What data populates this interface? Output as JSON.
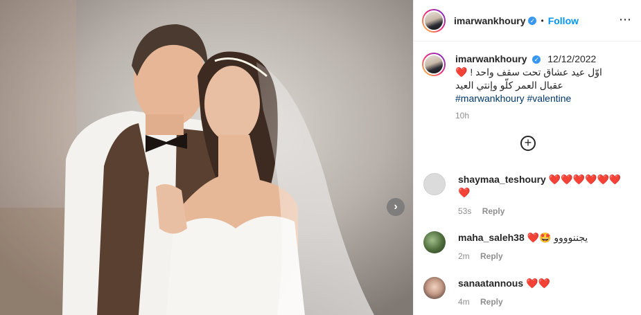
{
  "post": {
    "username": "imarwankhoury",
    "follow_label": "Follow",
    "dot": "•",
    "more_label": "⋯",
    "next_label": "›"
  },
  "caption": {
    "username": "imarwankhoury",
    "date": "12/12/2022",
    "line1": "اوّل عيد عشاق تحت سقف واحد !",
    "line1_emoji": "❤️",
    "line2": "عقبال العمر كلّو وإنتي العيد",
    "hashtag1": "#marwankhoury",
    "hashtag2": "#valentine",
    "time": "10h"
  },
  "load_more": "+",
  "comments": [
    {
      "username": "shaymaa_teshoury",
      "text": "❤️❤️❤️❤️❤️❤️❤️",
      "time": "53s",
      "reply": "Reply"
    },
    {
      "username": "maha_saleh38",
      "text": "يجننوووو 🤩❤️",
      "time": "2m",
      "reply": "Reply"
    },
    {
      "username": "sanaatannous",
      "text": "❤️❤️",
      "time": "4m",
      "reply": "Reply"
    }
  ],
  "colors": {
    "link": "#0095f6",
    "hashtag": "#00376b",
    "heart": "#ed1c24",
    "muted": "#8e8e8e"
  }
}
